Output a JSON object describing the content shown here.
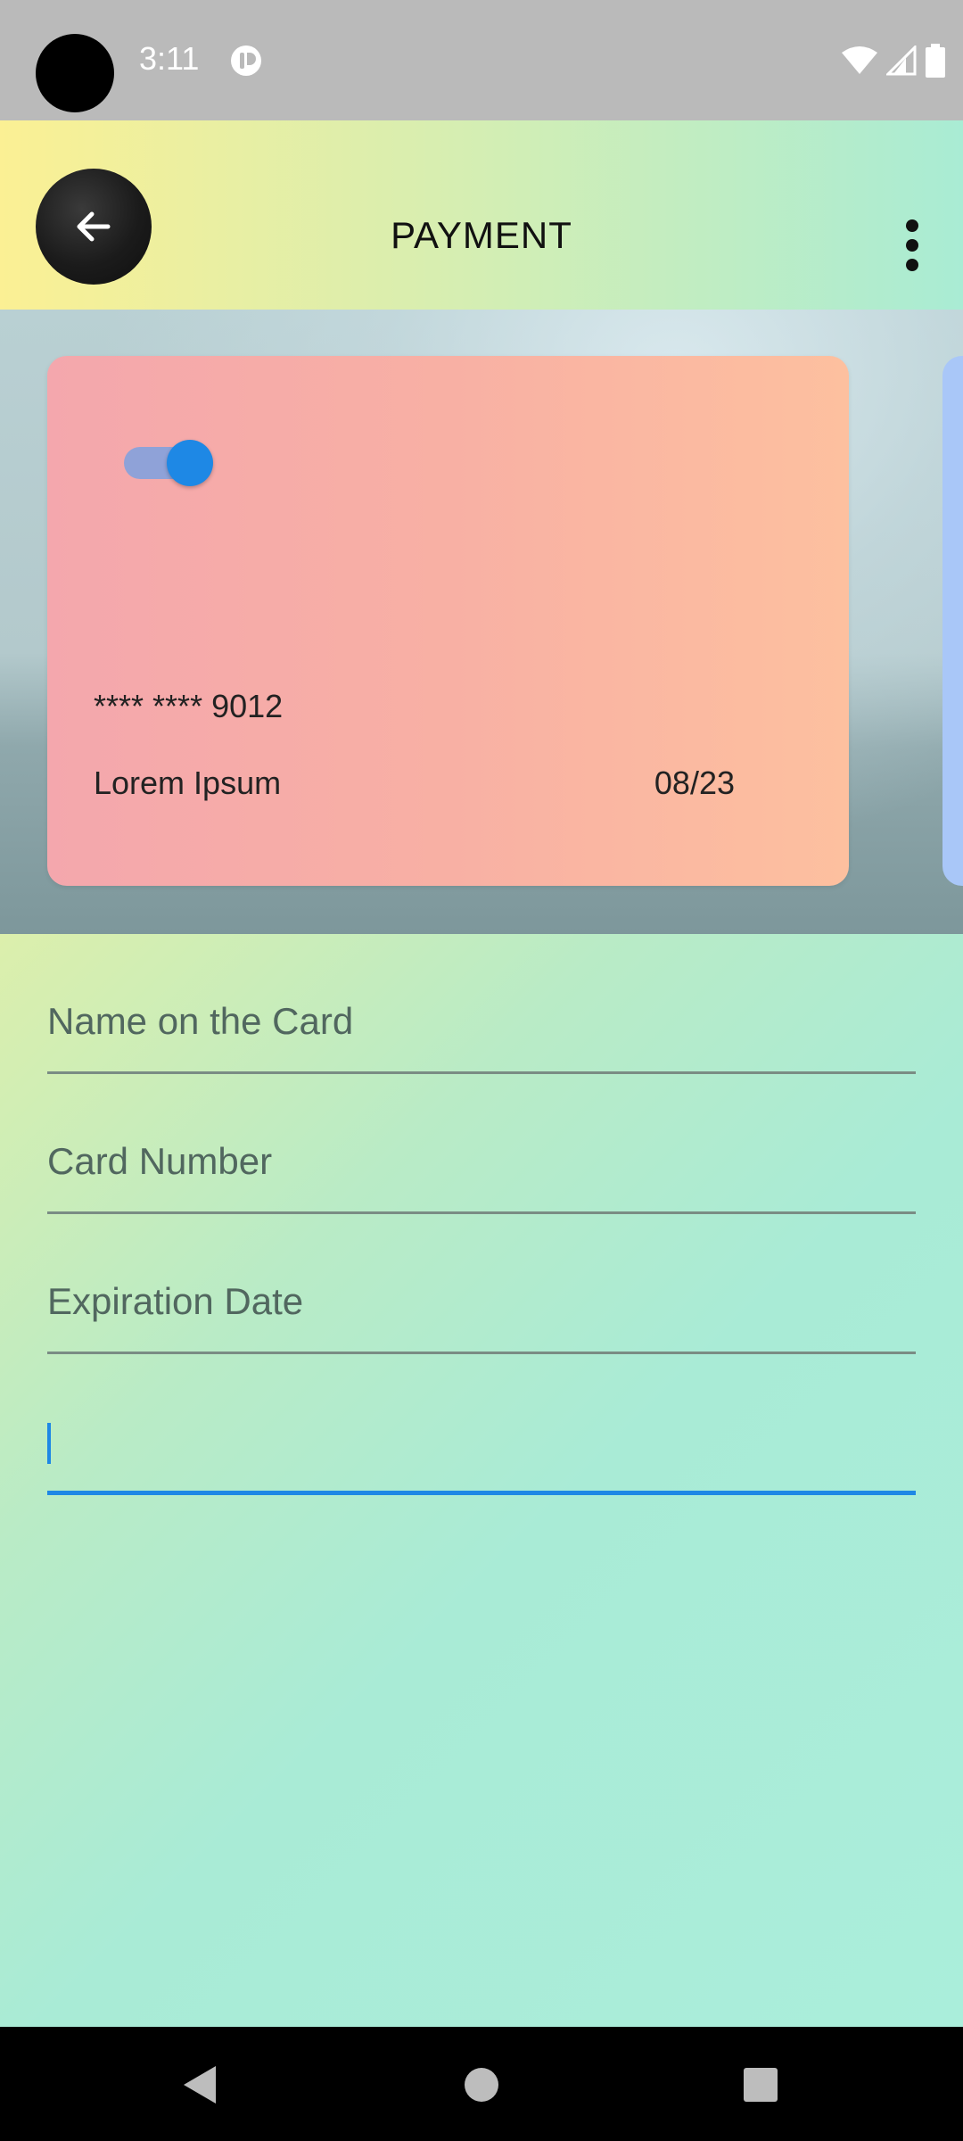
{
  "status_bar": {
    "time": "3:11"
  },
  "app_bar": {
    "title": "PAYMENT",
    "back_icon": "arrow-back-icon",
    "menu_icon": "more-vert-icon"
  },
  "card": {
    "toggle_on": true,
    "number": "**** **** 9012",
    "holder": "Lorem Ipsum",
    "expiry": "08/23",
    "colors": {
      "start": "#f4a7ad",
      "end": "#fdc09f",
      "next_card": "#a9c7f8"
    }
  },
  "form": {
    "fields": [
      {
        "label": "Name on the Card",
        "value": ""
      },
      {
        "label": "Card Number",
        "value": ""
      },
      {
        "label": "Expiration Date",
        "value": ""
      },
      {
        "label": "",
        "value": ""
      }
    ],
    "accent": "#1e88e5"
  },
  "nav_bar": {
    "icons": [
      "back-triangle-icon",
      "home-circle-icon",
      "recents-square-icon"
    ]
  }
}
